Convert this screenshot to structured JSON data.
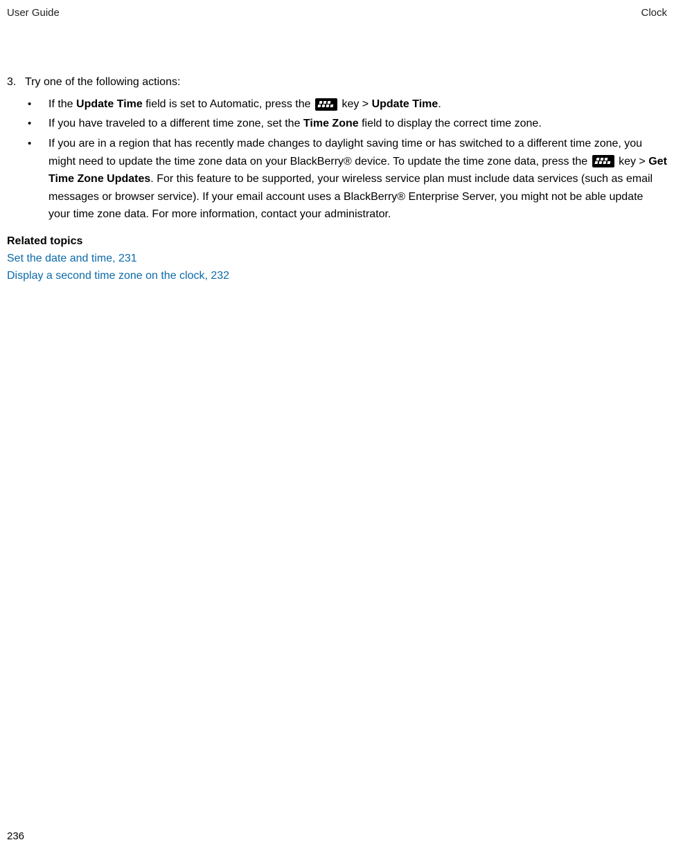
{
  "header": {
    "left": "User Guide",
    "right": "Clock"
  },
  "step": {
    "num": "3.",
    "text": "Try one of the following actions:"
  },
  "bullets": {
    "b1": {
      "pre": "If the ",
      "bold1": "Update Time",
      "mid": " field is set to Automatic, press the ",
      "post": " key > ",
      "bold2": "Update Time",
      "end": "."
    },
    "b2": {
      "pre": "If you have traveled to a different time zone, set the ",
      "bold1": "Time Zone",
      "post": " field to display the correct time zone."
    },
    "b3": {
      "pre": "If you are in a region that has recently made changes to daylight saving time or has switched to a different time zone, you might need to update the time zone data on your BlackBerry® device. To update the time zone data, press the ",
      "mid": " key > ",
      "bold1": "Get Time Zone Updates",
      "post": ". For this feature to be supported, your wireless service plan must include data services (such as email messages or browser service). If your email account uses a BlackBerry® Enterprise Server, you might not be able update your time zone data. For more information, contact your administrator."
    }
  },
  "related": {
    "heading": "Related topics",
    "link1": "Set the date and time, 231",
    "link2": "Display a second time zone on the clock, 232"
  },
  "footer": {
    "pagenum": "236"
  }
}
